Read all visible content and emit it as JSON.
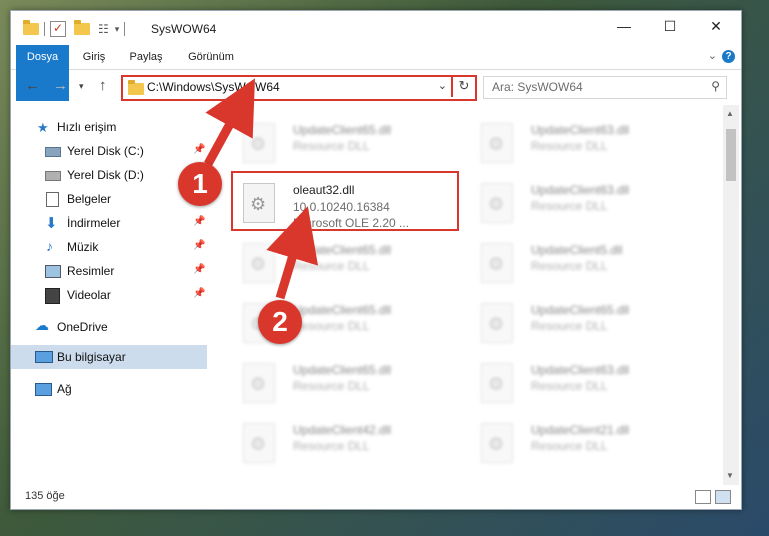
{
  "window": {
    "title": "SysWOW64"
  },
  "ribbon": {
    "tabs": [
      "Dosya",
      "Giriş",
      "Paylaş",
      "Görünüm"
    ],
    "help": "?"
  },
  "nav": {
    "address": "C:\\Windows\\SysWOW64",
    "search_placeholder": "Ara: SysWOW64"
  },
  "sidebar": {
    "items": [
      {
        "label": "Hızlı erişim",
        "icon": "star-icon",
        "pinned": false
      },
      {
        "label": "Yerel Disk (C:)",
        "icon": "drive-icon",
        "pinned": true
      },
      {
        "label": "Yerel Disk (D:)",
        "icon": "drive-icon",
        "pinned": true
      },
      {
        "label": "Belgeler",
        "icon": "documents-icon",
        "pinned": true
      },
      {
        "label": "İndirmeler",
        "icon": "download-icon",
        "pinned": true
      },
      {
        "label": "Müzik",
        "icon": "music-icon",
        "pinned": true
      },
      {
        "label": "Resimler",
        "icon": "pictures-icon",
        "pinned": true
      },
      {
        "label": "Videolar",
        "icon": "videos-icon",
        "pinned": true
      },
      {
        "label": "OneDrive",
        "icon": "cloud-icon",
        "pinned": false
      },
      {
        "label": "Bu bilgisayar",
        "icon": "computer-icon",
        "pinned": false
      },
      {
        "label": "Ağ",
        "icon": "network-icon",
        "pinned": false
      }
    ]
  },
  "files": {
    "left": [
      {
        "name": "UpdateClient65.dll",
        "type": "Resource DLL"
      },
      {
        "name": "UpdateClient65.dll",
        "type": "Resource DLL"
      },
      {
        "name": "UpdateClient65.dll",
        "type": "Resource DLL"
      },
      {
        "name": "UpdateClient65.dll",
        "type": "Resource DLL"
      },
      {
        "name": "UpdateClient42.dll",
        "type": "Resource DLL"
      }
    ],
    "right": [
      {
        "name": "UpdateClient63.dll",
        "type": "Resource DLL"
      },
      {
        "name": "UpdateClient63.dll",
        "type": "Resource DLL"
      },
      {
        "name": "UpdateClient5.dll",
        "type": "Resource DLL"
      },
      {
        "name": "UpdateClient65.dll",
        "type": "Resource DLL"
      },
      {
        "name": "UpdateClient63.dll",
        "type": "Resource DLL"
      },
      {
        "name": "UpdateClient21.dll",
        "type": "Resource DLL"
      }
    ],
    "highlighted": {
      "name": "oleaut32.dll",
      "version": "10.0.10240.16384",
      "description": "Microsoft OLE 2.20 ..."
    }
  },
  "status": {
    "count": "135 öğe"
  },
  "annotations": {
    "step1": "1",
    "step2": "2"
  },
  "colors": {
    "accent": "#1979ca",
    "highlight": "#d9362c",
    "selected": "#ccdcec"
  }
}
